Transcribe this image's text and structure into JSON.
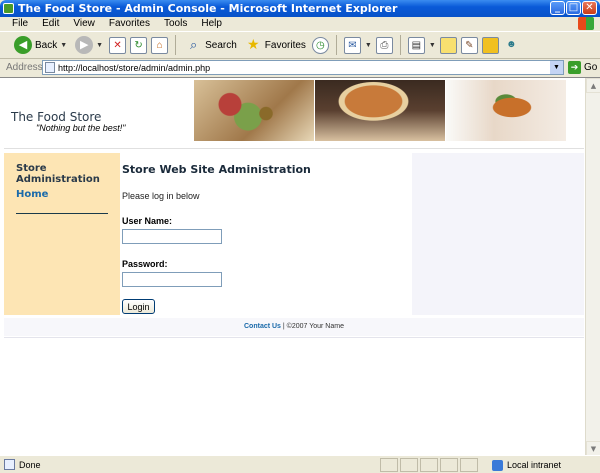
{
  "window": {
    "title": "The Food Store - Admin Console - Microsoft Internet Explorer",
    "buttons": {
      "minimize": "_",
      "maximize": "□",
      "close": "✕"
    }
  },
  "menu": [
    "File",
    "Edit",
    "View",
    "Favorites",
    "Tools",
    "Help"
  ],
  "toolbar": {
    "back_label": "Back",
    "search_label": "Search",
    "favorites_label": "Favorites"
  },
  "address": {
    "label": "Address",
    "url": "http://localhost/store/admin/admin.php",
    "go_label": "Go"
  },
  "site": {
    "store_name": "The Food Store",
    "tagline": "\"Nothing but the best!\""
  },
  "sidebar": {
    "title": "Store Administration",
    "home_link": "Home"
  },
  "main": {
    "heading": "Store Web Site Administration",
    "intro": "Please log in below",
    "username_label": "User Name:",
    "password_label": "Password:",
    "login_button": "Login"
  },
  "footer": {
    "contact_link": "Contact Us",
    "copyright": " | ©2007 Your Name"
  },
  "status": {
    "text": "Done",
    "zone": "Local intranet"
  }
}
